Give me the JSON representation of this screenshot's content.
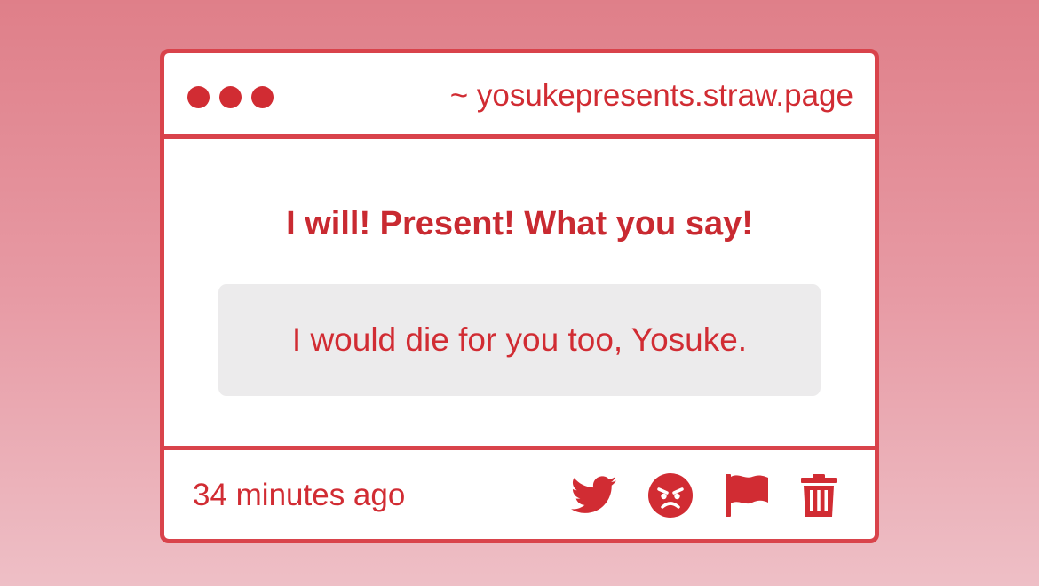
{
  "window": {
    "url": "~ yosukepresents.straw.page"
  },
  "main": {
    "headline": "I will! Present! What you say!",
    "message": "I would die for you too, Yosuke."
  },
  "footer": {
    "timestamp": "34 minutes ago",
    "actions": [
      {
        "icon": "twitter-icon"
      },
      {
        "icon": "angry-face-icon"
      },
      {
        "icon": "flag-icon"
      },
      {
        "icon": "trash-icon"
      }
    ]
  },
  "colors": {
    "accent": "#d12c33",
    "border": "#d9434b",
    "message_bg": "#ecebec",
    "background_top": "#df7f89",
    "background_bottom": "#eebfc6"
  }
}
